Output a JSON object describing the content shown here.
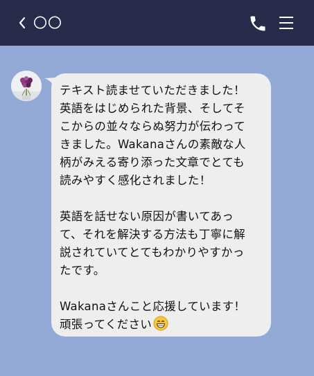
{
  "header": {
    "title": "〇〇",
    "icons": {
      "back": "chevron-left-icon",
      "call": "phone-icon",
      "menu": "hamburger-menu-icon"
    }
  },
  "message": {
    "paragraphs": [
      "テキスト読ませていただきました！\n英語をはじめられた背景、そしてそ\nこからの並々ならぬ努力が伝わって\nきました。Wakanaさんの素敵な人\n柄がみえる寄り添った文章でとても\n読みやすく感化されました！",
      "英語を話せない原因が書いてあっ\nて、それを解決する方法も丁寧に解\n説されていてとてもわかりやすかっ\nたです。",
      "Wakanaさんこと応援しています！\n頑張ってください"
    ],
    "emoji": "grinning-face-icon"
  },
  "colors": {
    "header_bg": "#272c4a",
    "chat_bg": "#93a9d6",
    "bubble_bg": "#eeeeee"
  }
}
